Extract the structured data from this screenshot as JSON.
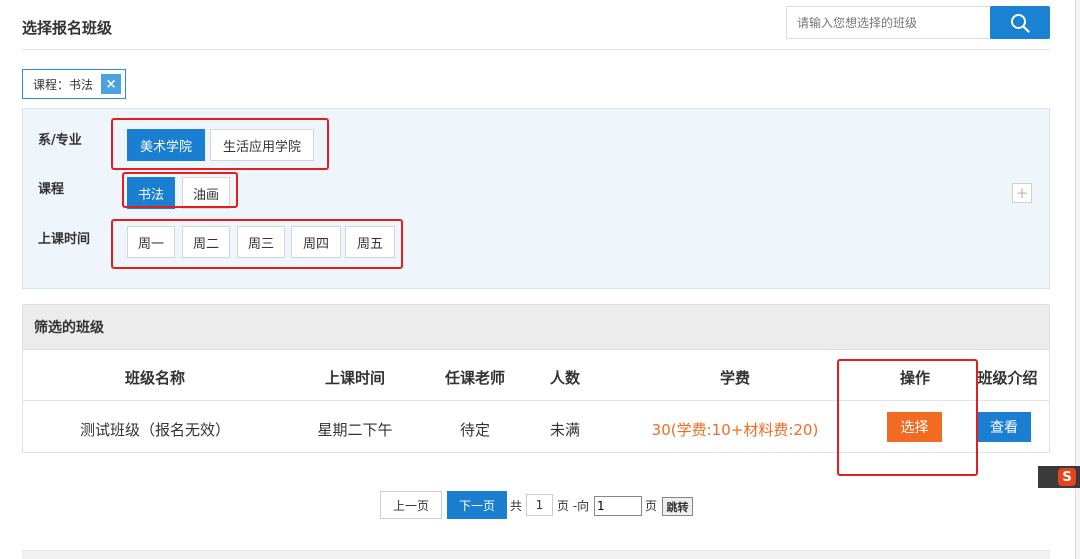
{
  "header": {
    "title": "选择报名班级",
    "search_placeholder": "请输入您想选择的班级"
  },
  "active_filter": {
    "label": "课程：书法",
    "remove_icon": "×"
  },
  "filters": {
    "department": {
      "label": "系/专业",
      "options": [
        "美术学院",
        "生活应用学院"
      ],
      "selected": "美术学院"
    },
    "course": {
      "label": "课程",
      "options": [
        "书法",
        "油画"
      ],
      "selected": "书法"
    },
    "schedule": {
      "label": "上课时间",
      "options": [
        "周一",
        "周二",
        "周三",
        "周四",
        "周五"
      ]
    },
    "expand_icon": "+"
  },
  "results": {
    "title": "筛选的班级",
    "columns": [
      "班级名称",
      "上课时间",
      "任课老师",
      "人数",
      "学费",
      "操作",
      "班级介绍"
    ],
    "rows": [
      {
        "name": "测试班级（报名无效）",
        "time": "星期二下午",
        "teacher": "待定",
        "capacity": "未满",
        "fee": "30(学费:10+材料费:20)",
        "action": "选择",
        "intro": "查看"
      }
    ]
  },
  "pagination": {
    "prev": "上一页",
    "next": "下一页",
    "total_prefix": "共",
    "total_pages": "1",
    "total_suffix": "页 -向",
    "jump_value": "1",
    "jump_suffix": "页",
    "jump_button": "跳转"
  },
  "ime": {
    "label": "S"
  },
  "colors": {
    "primary": "#1a7fd0",
    "accent_orange": "#f26b22",
    "highlight_red": "#e21e1e",
    "panel_bg": "#eef6fc"
  }
}
